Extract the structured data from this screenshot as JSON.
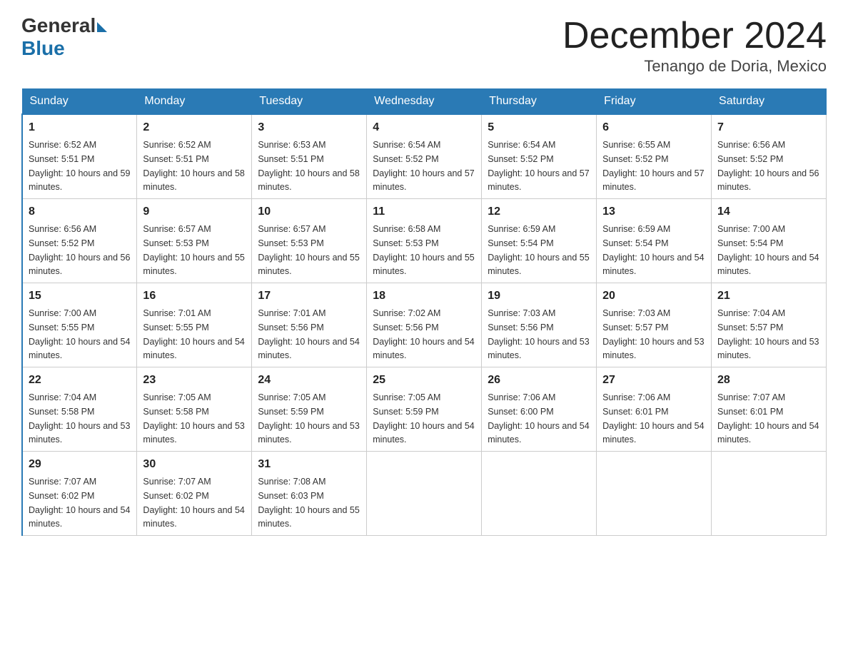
{
  "header": {
    "logo": {
      "general": "General",
      "blue": "Blue"
    },
    "title": "December 2024",
    "location": "Tenango de Doria, Mexico"
  },
  "calendar": {
    "days_of_week": [
      "Sunday",
      "Monday",
      "Tuesday",
      "Wednesday",
      "Thursday",
      "Friday",
      "Saturday"
    ],
    "weeks": [
      [
        {
          "day": "1",
          "sunrise": "6:52 AM",
          "sunset": "5:51 PM",
          "daylight": "10 hours and 59 minutes."
        },
        {
          "day": "2",
          "sunrise": "6:52 AM",
          "sunset": "5:51 PM",
          "daylight": "10 hours and 58 minutes."
        },
        {
          "day": "3",
          "sunrise": "6:53 AM",
          "sunset": "5:51 PM",
          "daylight": "10 hours and 58 minutes."
        },
        {
          "day": "4",
          "sunrise": "6:54 AM",
          "sunset": "5:52 PM",
          "daylight": "10 hours and 57 minutes."
        },
        {
          "day": "5",
          "sunrise": "6:54 AM",
          "sunset": "5:52 PM",
          "daylight": "10 hours and 57 minutes."
        },
        {
          "day": "6",
          "sunrise": "6:55 AM",
          "sunset": "5:52 PM",
          "daylight": "10 hours and 57 minutes."
        },
        {
          "day": "7",
          "sunrise": "6:56 AM",
          "sunset": "5:52 PM",
          "daylight": "10 hours and 56 minutes."
        }
      ],
      [
        {
          "day": "8",
          "sunrise": "6:56 AM",
          "sunset": "5:52 PM",
          "daylight": "10 hours and 56 minutes."
        },
        {
          "day": "9",
          "sunrise": "6:57 AM",
          "sunset": "5:53 PM",
          "daylight": "10 hours and 55 minutes."
        },
        {
          "day": "10",
          "sunrise": "6:57 AM",
          "sunset": "5:53 PM",
          "daylight": "10 hours and 55 minutes."
        },
        {
          "day": "11",
          "sunrise": "6:58 AM",
          "sunset": "5:53 PM",
          "daylight": "10 hours and 55 minutes."
        },
        {
          "day": "12",
          "sunrise": "6:59 AM",
          "sunset": "5:54 PM",
          "daylight": "10 hours and 55 minutes."
        },
        {
          "day": "13",
          "sunrise": "6:59 AM",
          "sunset": "5:54 PM",
          "daylight": "10 hours and 54 minutes."
        },
        {
          "day": "14",
          "sunrise": "7:00 AM",
          "sunset": "5:54 PM",
          "daylight": "10 hours and 54 minutes."
        }
      ],
      [
        {
          "day": "15",
          "sunrise": "7:00 AM",
          "sunset": "5:55 PM",
          "daylight": "10 hours and 54 minutes."
        },
        {
          "day": "16",
          "sunrise": "7:01 AM",
          "sunset": "5:55 PM",
          "daylight": "10 hours and 54 minutes."
        },
        {
          "day": "17",
          "sunrise": "7:01 AM",
          "sunset": "5:56 PM",
          "daylight": "10 hours and 54 minutes."
        },
        {
          "day": "18",
          "sunrise": "7:02 AM",
          "sunset": "5:56 PM",
          "daylight": "10 hours and 54 minutes."
        },
        {
          "day": "19",
          "sunrise": "7:03 AM",
          "sunset": "5:56 PM",
          "daylight": "10 hours and 53 minutes."
        },
        {
          "day": "20",
          "sunrise": "7:03 AM",
          "sunset": "5:57 PM",
          "daylight": "10 hours and 53 minutes."
        },
        {
          "day": "21",
          "sunrise": "7:04 AM",
          "sunset": "5:57 PM",
          "daylight": "10 hours and 53 minutes."
        }
      ],
      [
        {
          "day": "22",
          "sunrise": "7:04 AM",
          "sunset": "5:58 PM",
          "daylight": "10 hours and 53 minutes."
        },
        {
          "day": "23",
          "sunrise": "7:05 AM",
          "sunset": "5:58 PM",
          "daylight": "10 hours and 53 minutes."
        },
        {
          "day": "24",
          "sunrise": "7:05 AM",
          "sunset": "5:59 PM",
          "daylight": "10 hours and 53 minutes."
        },
        {
          "day": "25",
          "sunrise": "7:05 AM",
          "sunset": "5:59 PM",
          "daylight": "10 hours and 54 minutes."
        },
        {
          "day": "26",
          "sunrise": "7:06 AM",
          "sunset": "6:00 PM",
          "daylight": "10 hours and 54 minutes."
        },
        {
          "day": "27",
          "sunrise": "7:06 AM",
          "sunset": "6:01 PM",
          "daylight": "10 hours and 54 minutes."
        },
        {
          "day": "28",
          "sunrise": "7:07 AM",
          "sunset": "6:01 PM",
          "daylight": "10 hours and 54 minutes."
        }
      ],
      [
        {
          "day": "29",
          "sunrise": "7:07 AM",
          "sunset": "6:02 PM",
          "daylight": "10 hours and 54 minutes."
        },
        {
          "day": "30",
          "sunrise": "7:07 AM",
          "sunset": "6:02 PM",
          "daylight": "10 hours and 54 minutes."
        },
        {
          "day": "31",
          "sunrise": "7:08 AM",
          "sunset": "6:03 PM",
          "daylight": "10 hours and 55 minutes."
        },
        null,
        null,
        null,
        null
      ]
    ]
  }
}
